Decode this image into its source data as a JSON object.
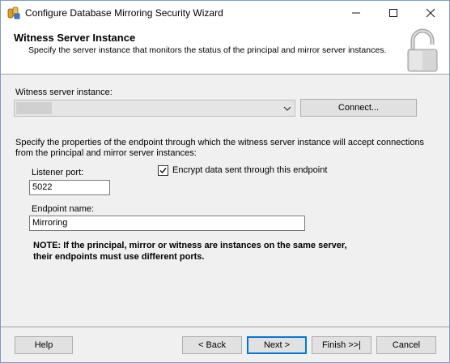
{
  "window": {
    "title": "Configure Database Mirroring Security Wizard",
    "controls": {
      "minimize": "minimize-icon",
      "maximize": "maximize-icon",
      "close": "close-icon"
    }
  },
  "header": {
    "title": "Witness Server Instance",
    "subtitle": "Specify the server instance that monitors the status of the principal and mirror server instances."
  },
  "witness": {
    "label": "Witness server instance:",
    "connect_label": "Connect..."
  },
  "description": "Specify the properties of the endpoint through which the witness server instance will accept connections from the principal and mirror server instances:",
  "listener": {
    "label": "Listener port:",
    "value": "5022"
  },
  "encrypt": {
    "label": "Encrypt data sent through this endpoint",
    "checked": true
  },
  "endpoint": {
    "label": "Endpoint name:",
    "value": "Mirroring"
  },
  "note": {
    "line1": "NOTE: If the principal, mirror or witness are instances on the same server,",
    "line2": "their endpoints must use different ports."
  },
  "footer": {
    "help": "Help",
    "back": "< Back",
    "next": "Next >",
    "finish": "Finish >>|",
    "cancel": "Cancel"
  }
}
